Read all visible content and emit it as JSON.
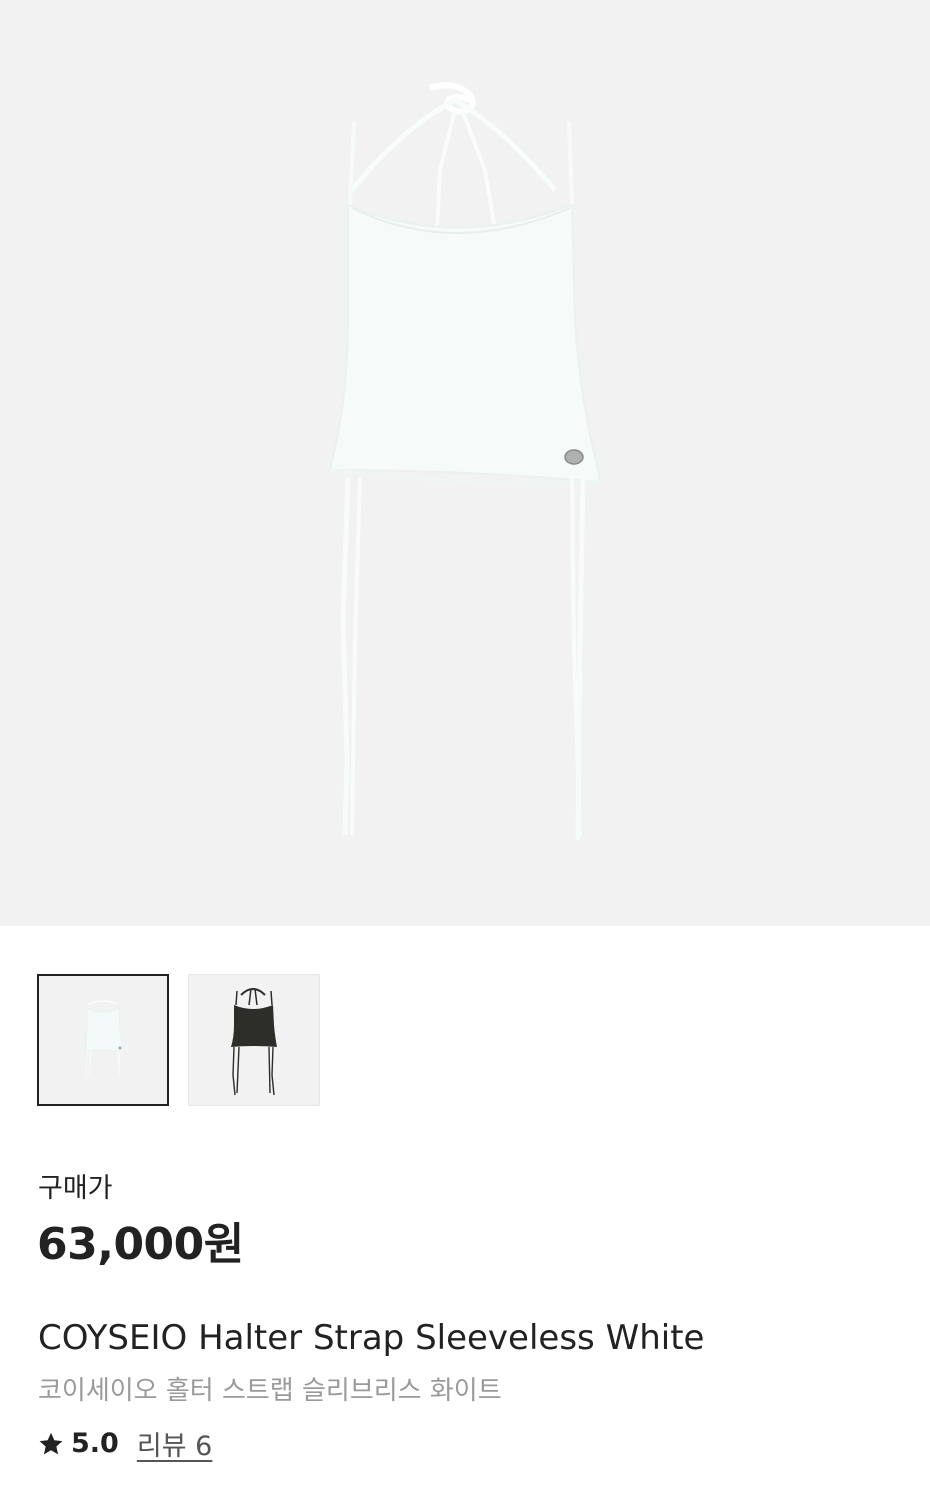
{
  "product": {
    "price_label": "구매가",
    "price": "63,000원",
    "name_en": "COYSEIO Halter Strap Sleeveless White",
    "name_ko": "코이세이오 홀터 스트랩 슬리브리스 화이트",
    "rating": "5.0",
    "review_link": "리뷰 6"
  },
  "thumbnails": [
    {
      "variant": "white",
      "selected": true
    },
    {
      "variant": "black",
      "selected": false
    }
  ],
  "colors": {
    "hero_bg": "#f2f2f2",
    "garment_white": "#f7fbfa",
    "garment_black": "#2d2d2a",
    "text_primary": "#222222",
    "text_secondary": "#9a9a9a"
  }
}
